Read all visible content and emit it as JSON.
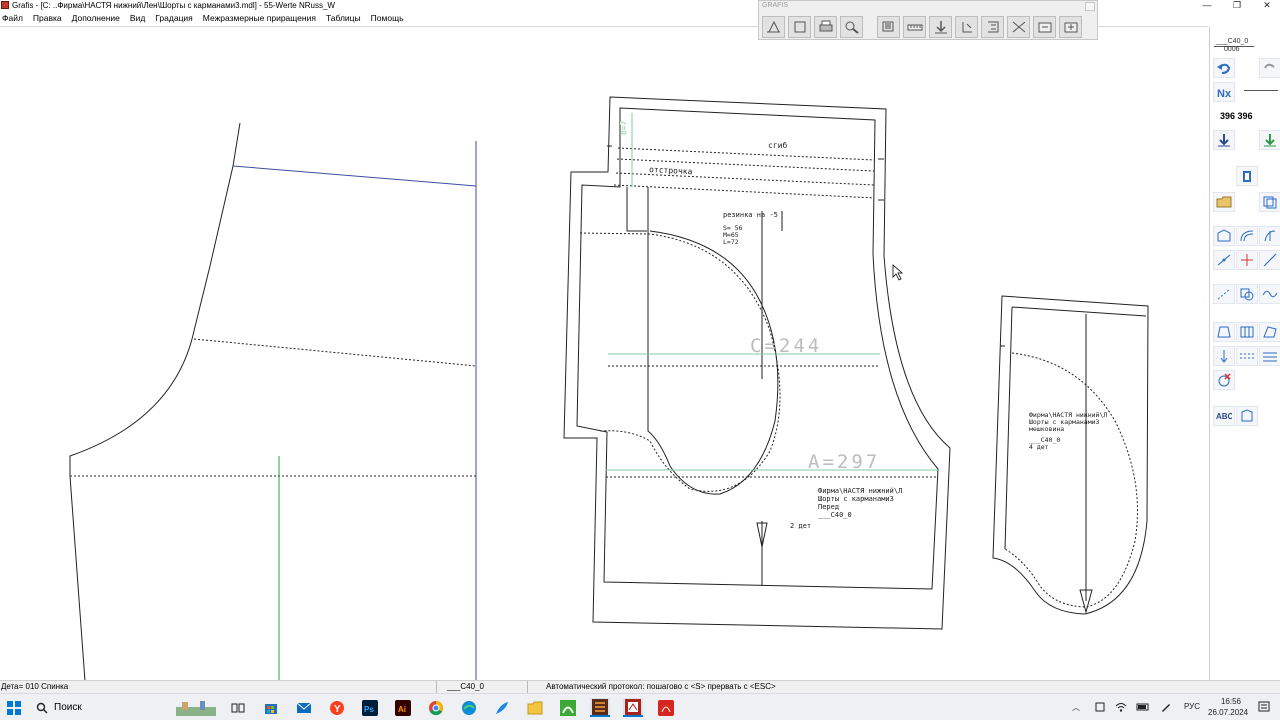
{
  "window": {
    "title": "Grafis - [C: ..Фирма\\НАСТЯ нижний\\Лен\\Шорты с карманами3.mdl] - 55-Werte NRuss_W",
    "minimize": "—",
    "restore": "❐",
    "close": "✕"
  },
  "menu": [
    "Файл",
    "Правка",
    "Дополнение",
    "Вид",
    "Градация",
    "Межразмерные приращения",
    "Таблицы",
    "Помощь"
  ],
  "toolbox": {
    "title": "GRAFIS",
    "buttons": [
      "pattern-tool-icon",
      "pattern-copy-icon",
      "print-icon",
      "zoom-icon",
      "layer-icon",
      "ruler-icon",
      "move-down-icon",
      "move-right-icon",
      "measure-icon",
      "cut-icon",
      "export-icon",
      "import-icon"
    ]
  },
  "drawing": {
    "fold_label": "сгиб",
    "stitch_label": "отстрочка",
    "elastic_title": "резинка на -5",
    "elastic_sizes": [
      "S= 56",
      "M=65",
      "L=72"
    ],
    "measure_vertical": "b=7",
    "measure_c": "C=244",
    "measure_a": "A=297",
    "front_info": [
      "Фирма\\НАСТЯ нижний\\Л",
      "Шорты с карманами3",
      "Перед",
      "___C40_0"
    ],
    "front_count": "2 дет",
    "pocket_info": [
      "Фирма\\НАСТЯ нижний\\Л",
      "Шорты с карманами3",
      "мешковина",
      "___C40_0"
    ],
    "pocket_count": "4 дет"
  },
  "right_panel": {
    "size_code": "___C40_0",
    "size_num": "0006",
    "coords": "396 396",
    "tools": [
      "undo-icon",
      "redo-icon",
      "grading-icon",
      "download-icon",
      "import-green-icon",
      "hanger-icon",
      "open-folder-icon",
      "copy-piece-icon",
      "shape-icon",
      "curve-icon",
      "split-icon",
      "line-icon",
      "cross-icon",
      "diagonal-icon",
      "points-icon",
      "rotate-icon",
      "wave-icon",
      "fold-icon",
      "panel-icon",
      "stripe-icon",
      "arrow-icon",
      "dash-icon",
      "layers-icon",
      "delete-icon",
      "spell-icon",
      "piece-icon"
    ]
  },
  "statusbar": {
    "left": "Дета= 010  Спинка",
    "mid": "___C40_0",
    "protocol": "Автоматический протокол: пошагово с <S> прервать с <ESC>"
  },
  "taskbar": {
    "search": "Поиск",
    "lang": "РУС",
    "time": "16:56",
    "date": "26.07.2024",
    "apps": [
      "widgets-icon",
      "task-view-icon",
      "store-icon",
      "mail-icon",
      "yandex-icon",
      "photoshop-icon",
      "illustrator-icon",
      "chrome-icon",
      "edge-icon",
      "feather-icon",
      "files-icon",
      "corel-icon",
      "grafis-app-icon",
      "grafis-app2-icon",
      "acrobat-icon"
    ]
  },
  "colors": {
    "accent": "#0078d4",
    "line_blue": "#3a4fa0",
    "grade_green": "#2e9b4a",
    "measure_green": "#7fce9e"
  }
}
